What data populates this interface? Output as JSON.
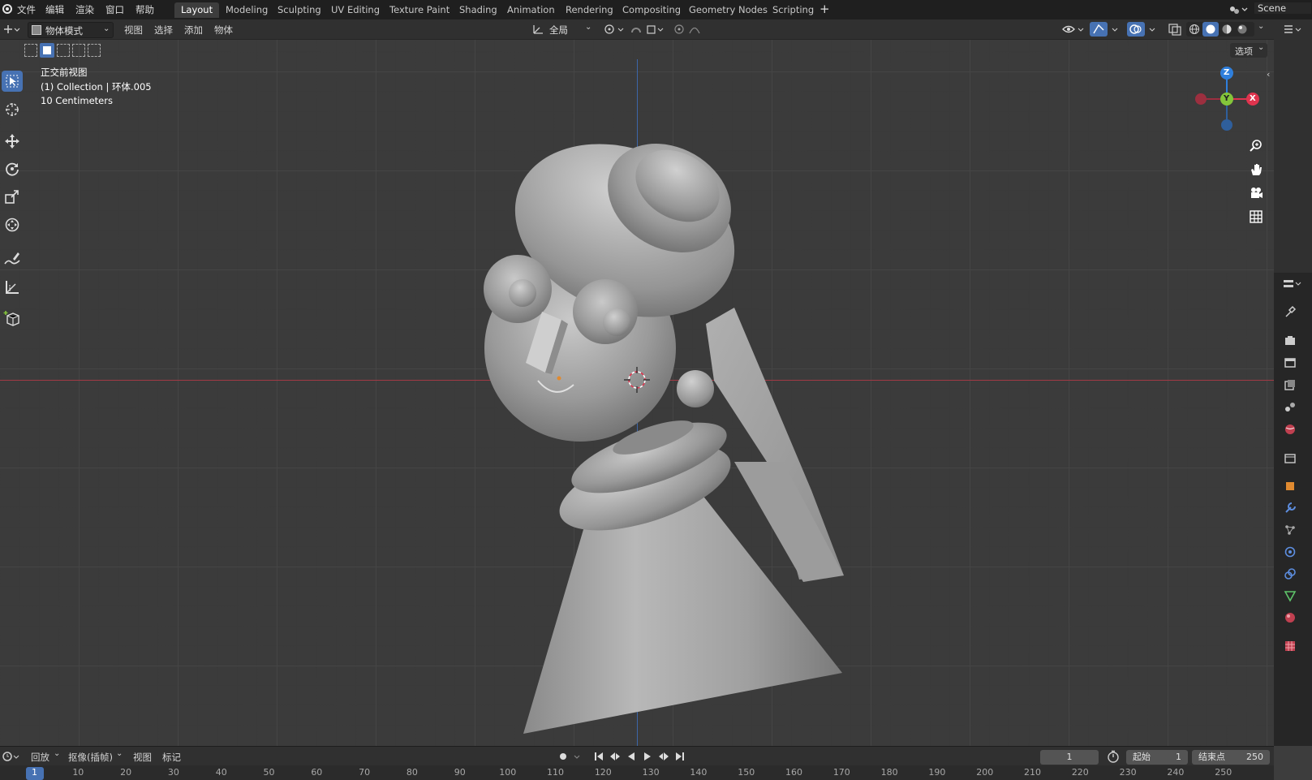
{
  "topbar": {
    "menus": [
      "文件",
      "编辑",
      "渲染",
      "窗口",
      "帮助"
    ],
    "workspace_tabs": [
      "Layout",
      "Modeling",
      "Sculpting",
      "UV Editing",
      "Texture Paint",
      "Shading",
      "Animation",
      "Rendering",
      "Compositing",
      "Geometry Nodes",
      "Scripting"
    ],
    "active_tab": "Layout",
    "add_tab": "+",
    "scene_name": "Scene"
  },
  "header": {
    "mode": "物体模式",
    "menus": [
      "视图",
      "选择",
      "添加",
      "物体"
    ],
    "orientation": "全局",
    "options_label": "选项"
  },
  "viewport": {
    "view_name": "正交前视图",
    "collection_info": "(1) Collection | 环体.005",
    "scale_info": "10 Centimeters",
    "gizmo": {
      "z": "Z",
      "y": "Y",
      "x": "X"
    }
  },
  "timeline": {
    "menus": [
      "回放",
      "抠像(插帧)",
      "视图",
      "标记"
    ],
    "current_frame": "1",
    "start_label": "起始",
    "start_value": "1",
    "end_label": "结束点",
    "end_value": "250",
    "ruler_ticks": [
      "1",
      "10",
      "20",
      "30",
      "40",
      "50",
      "60",
      "70",
      "80",
      "90",
      "100",
      "110",
      "120",
      "130",
      "140",
      "150",
      "160",
      "170",
      "180",
      "190",
      "200",
      "210",
      "220",
      "230",
      "240",
      "250"
    ]
  },
  "colors": {
    "accent": "#4772b3",
    "x_axis": "#e0344e",
    "y_axis": "#84c53a",
    "z_axis": "#2f7fdc"
  }
}
